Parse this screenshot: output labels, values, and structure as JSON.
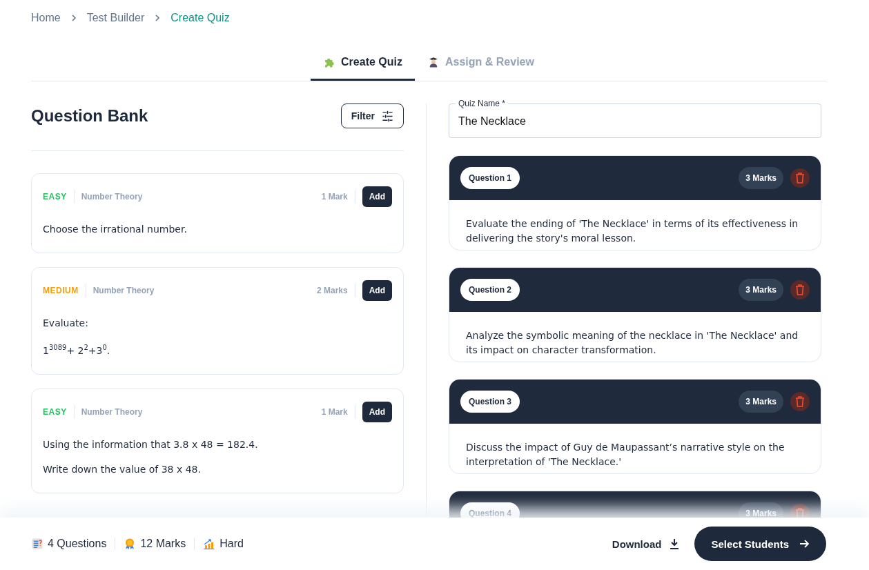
{
  "breadcrumb": [
    {
      "label": "Home",
      "current": false
    },
    {
      "label": "Test Builder",
      "current": false
    },
    {
      "label": "Create Quiz",
      "current": true
    }
  ],
  "tabs": [
    {
      "label": "Create Quiz",
      "selected": true
    },
    {
      "label": "Assign & Review",
      "selected": false
    }
  ],
  "question_bank": {
    "title": "Question Bank",
    "filter_button": "Filter",
    "questions": [
      {
        "difficulty": "EASY",
        "color": "#22c55e",
        "topic": "Number Theory",
        "marks": "1 Mark",
        "add_button": "Add",
        "lines": [
          "Choose the irrational number."
        ]
      },
      {
        "difficulty": "MEDIUM",
        "color": "#f59e0b",
        "topic": "Number Theory",
        "marks": "2 Marks",
        "add_button": "Add",
        "lines": [
          "Evaluate:",
          "1$^{3089}$+ 2$^{2}$+3$^{0}$."
        ]
      },
      {
        "difficulty": "EASY",
        "color": "#22c55e",
        "topic": "Number Theory",
        "marks": "1 Mark",
        "add_button": "Add",
        "lines": [
          "Using the information that 3.8 x 48 = 182.4.",
          "Write down the value of 38 x 48."
        ]
      }
    ]
  },
  "quiz": {
    "name_label": "Quiz Name *",
    "name_value": "The Necklace",
    "questions": [
      {
        "label": "Question 1",
        "marks": "3 Marks",
        "text": "Evaluate the ending of 'The Necklace' in terms of its effectiveness in delivering the story's moral lesson."
      },
      {
        "label": "Question 2",
        "marks": "3 Marks",
        "text": "Analyze the symbolic meaning of the necklace in 'The Necklace' and its impact on character transformation."
      },
      {
        "label": "Question 3",
        "marks": "3 Marks",
        "text": "Discuss the impact of Guy de Maupassant’s narrative style on the interpretation of 'The Necklace.'"
      },
      {
        "label": "Question 4",
        "marks": "3 Marks"
      }
    ]
  },
  "footer": {
    "stats": [
      {
        "text": "4 Questions"
      },
      {
        "text": "12 Marks"
      },
      {
        "text": "Hard"
      }
    ],
    "download_button": "Download",
    "next_button": "Select Students"
  }
}
